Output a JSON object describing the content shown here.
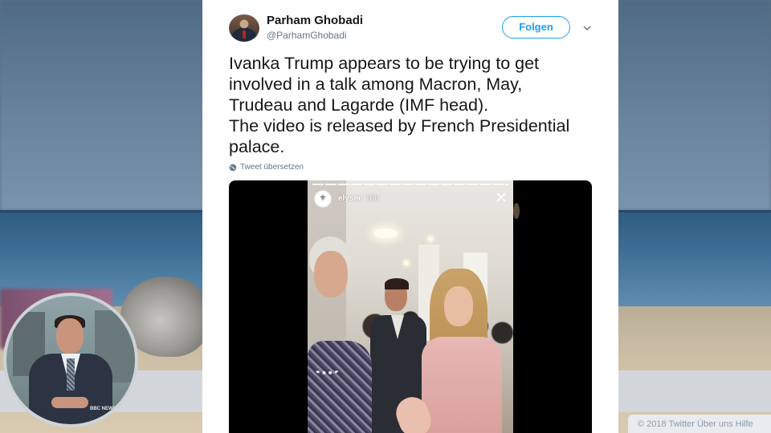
{
  "tweet": {
    "author_name": "Parham Ghobadi",
    "author_handle": "@ParhamGhobadi",
    "follow_label": "Folgen",
    "text_lines": [
      "Ivanka Trump appears to be trying to get",
      "involved in a talk among Macron, May,",
      "Trudeau and Lagarde (IMF head).",
      "The video is released by French Presidential",
      "palace."
    ],
    "translate_label": "Tweet übersetzen"
  },
  "video": {
    "story_user": "elysee",
    "story_time": "18h"
  },
  "footer": {
    "text": "© 2018 Twitter   Über uns   Hilfe"
  },
  "presenter": {
    "logo_text": "BBC NEWS"
  },
  "icons": {
    "chevron": "chevron-down-icon",
    "globe": "globe-icon",
    "close": "close-icon"
  },
  "colors": {
    "accent": "#1da1f2",
    "text": "#14171a",
    "secondary": "#657786"
  }
}
